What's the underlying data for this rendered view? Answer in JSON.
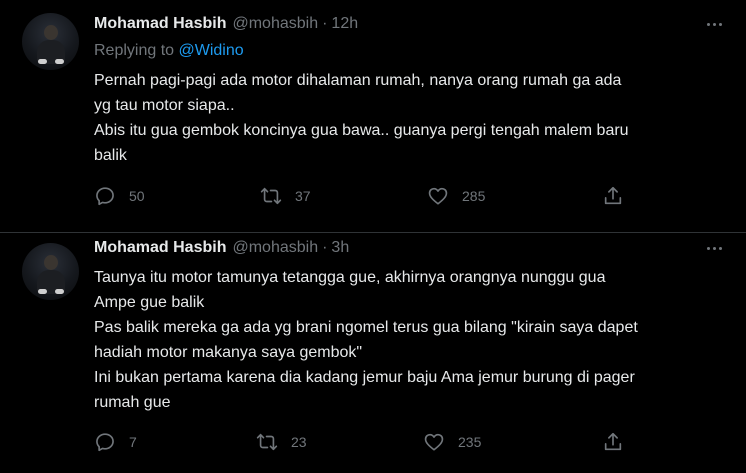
{
  "tweets": [
    {
      "author_name": "Mohamad Hasbih",
      "handle": "@mohasbih",
      "separator": "·",
      "time": "12h",
      "replying_prefix": "Replying to ",
      "replying_to": "@Widino",
      "lines": [
        "Pernah pagi-pagi ada motor dihalaman rumah, nanya orang rumah ga ada",
        "yg tau motor siapa..",
        "Abis itu gua gembok koncinya gua bawa.. guanya pergi tengah malem baru",
        "balik"
      ],
      "replies": "50",
      "retweets": "37",
      "likes": "285"
    },
    {
      "author_name": "Mohamad Hasbih",
      "handle": "@mohasbih",
      "separator": "·",
      "time": "3h",
      "lines": [
        "Taunya itu motor tamunya tetangga gue, akhirnya orangnya nunggu gua",
        "Ampe gue balik",
        "Pas balik mereka ga ada yg brani ngomel terus gua bilang \"kirain saya dapet",
        "hadiah motor makanya saya gembok\"",
        "Ini bukan pertama karena dia kadang jemur baju Ama jemur burung di pager",
        "rumah gue"
      ],
      "replies": "7",
      "retweets": "23",
      "likes": "235"
    }
  ],
  "icons": {
    "reply": "reply-icon",
    "retweet": "retweet-icon",
    "like": "heart-icon",
    "share": "share-icon",
    "more": "more-icon"
  },
  "colors": {
    "background": "#000000",
    "text": "#e7e9ea",
    "secondary": "#71767b",
    "link": "#1d9bf0"
  }
}
